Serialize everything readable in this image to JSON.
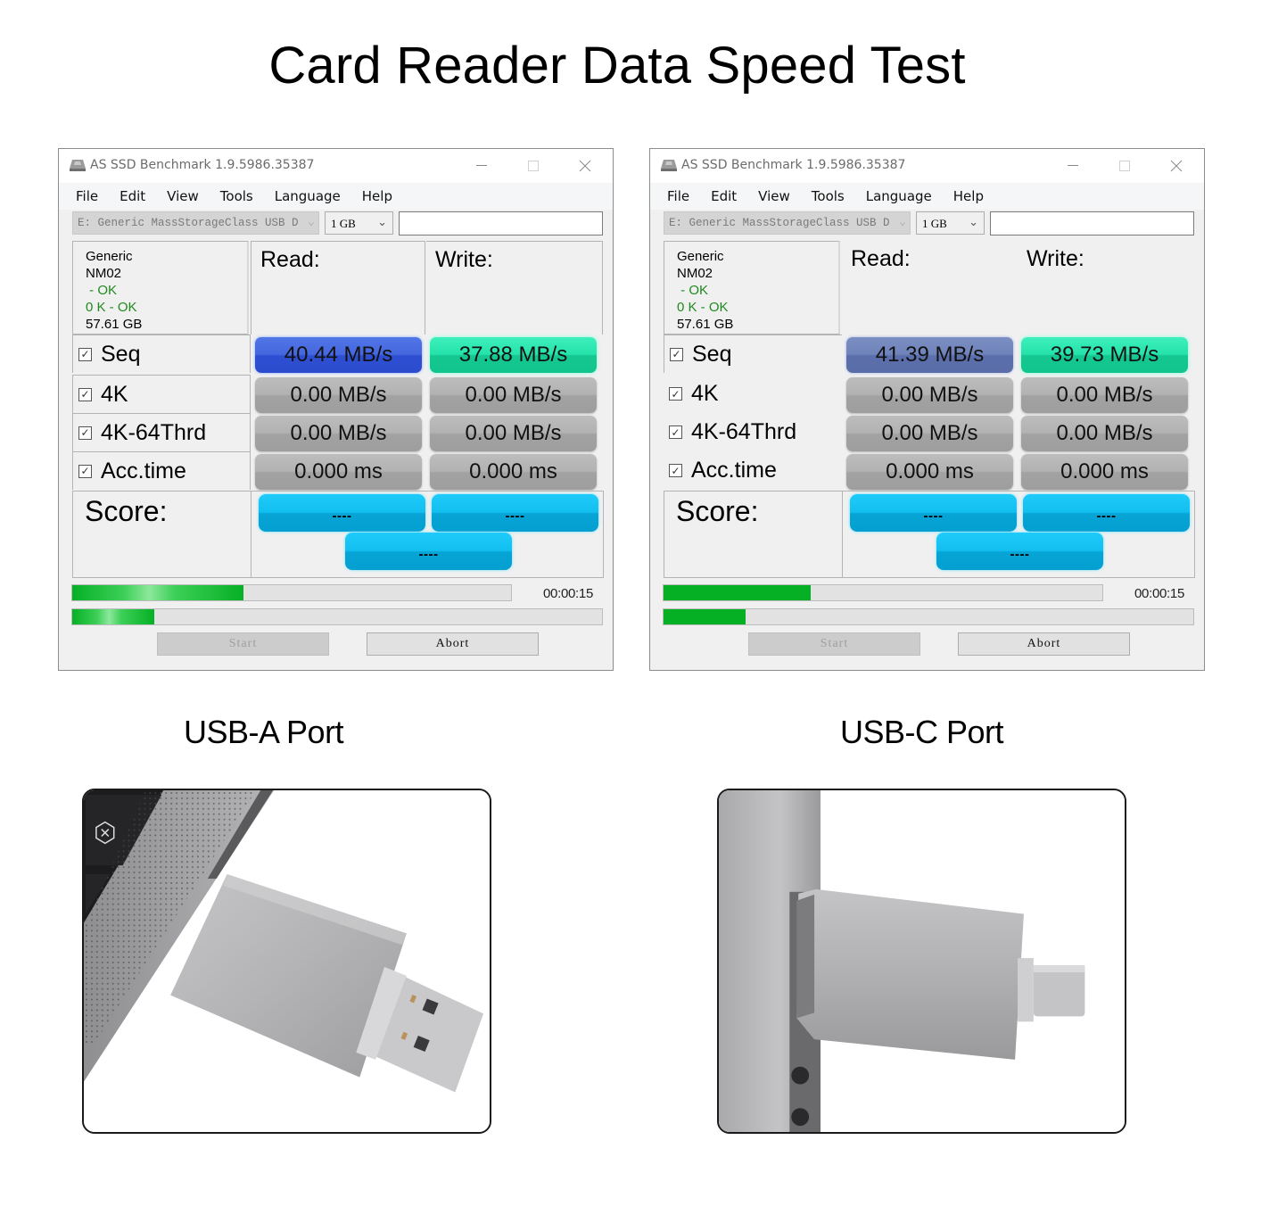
{
  "page": {
    "title": "Card Reader Data Speed Test"
  },
  "windows": [
    {
      "id": "usb-a",
      "title": "AS SSD Benchmark 1.9.5986.35387",
      "menu": [
        "File",
        "Edit",
        "View",
        "Tools",
        "Language",
        "Help"
      ],
      "drive_select": "E: Generic MassStorageClass USB D",
      "size_select": "1 GB",
      "text_field_value": "",
      "info": {
        "vendor": "Generic",
        "model": "NM02",
        "status1": " - OK",
        "status2": "0 K - OK",
        "capacity": "57.61 GB"
      },
      "read_header": "Read:",
      "write_header": "Write:",
      "rows": [
        {
          "label": "Seq",
          "checked": true,
          "read": "40.44 MB/s",
          "write": "37.88 MB/s"
        },
        {
          "label": "4K",
          "checked": true,
          "read": "0.00 MB/s",
          "write": "0.00 MB/s"
        },
        {
          "label": "4K-64Thrd",
          "checked": true,
          "read": "0.00 MB/s",
          "write": "0.00 MB/s"
        },
        {
          "label": "Acc.time",
          "checked": true,
          "read": "0.000 ms",
          "write": "0.000 ms"
        }
      ],
      "score_label": "Score:",
      "scores": {
        "read": "----",
        "write": "----",
        "total": "----"
      },
      "progress_total": 0.39,
      "progress_step": 0.155,
      "elapsed": "00:00:15",
      "start_label": "Start",
      "abort_label": "Abort"
    },
    {
      "id": "usb-c",
      "title": "AS SSD Benchmark 1.9.5986.35387",
      "menu": [
        "File",
        "Edit",
        "View",
        "Tools",
        "Language",
        "Help"
      ],
      "drive_select": "E: Generic MassStorageClass USB D",
      "size_select": "1 GB",
      "text_field_value": "",
      "info": {
        "vendor": "Generic",
        "model": "NM02",
        "status1": " - OK",
        "status2": "0 K - OK",
        "capacity": "57.61 GB"
      },
      "read_header": "Read:",
      "write_header": "Write:",
      "rows": [
        {
          "label": "Seq",
          "checked": true,
          "read": "41.39 MB/s",
          "write": "39.73 MB/s"
        },
        {
          "label": "4K",
          "checked": true,
          "read": "0.00 MB/s",
          "write": "0.00 MB/s"
        },
        {
          "label": "4K-64Thrd",
          "checked": true,
          "read": "0.00 MB/s",
          "write": "0.00 MB/s"
        },
        {
          "label": "Acc.time",
          "checked": true,
          "read": "0.000 ms",
          "write": "0.000 ms"
        }
      ],
      "score_label": "Score:",
      "scores": {
        "read": "----",
        "write": "----",
        "total": "----"
      },
      "progress_total": 0.335,
      "progress_step": 0.155,
      "elapsed": "00:00:15",
      "start_label": "Start",
      "abort_label": "Abort"
    }
  ],
  "captions": {
    "usb_a": "USB-A Port",
    "usb_c": "USB-C Port"
  },
  "colors": {
    "seq_read_usb_a": "#2e4fd3",
    "seq_read_usb_c": "#5b6fac",
    "seq_write": "#14c890",
    "zero_value": "#a2a2a2",
    "score": "#07a4d6",
    "progress": "#06b025"
  }
}
